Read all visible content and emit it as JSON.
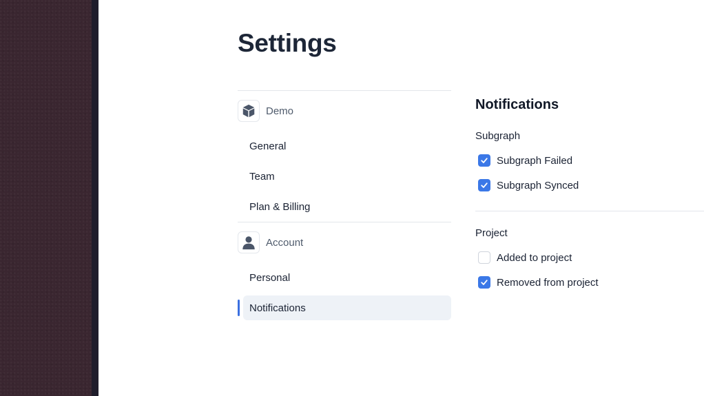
{
  "page": {
    "title": "Settings"
  },
  "sidebar": {
    "sections": [
      {
        "label": "Demo",
        "icon": "cube-icon",
        "items": [
          {
            "label": "General",
            "active": false
          },
          {
            "label": "Team",
            "active": false
          },
          {
            "label": "Plan & Billing",
            "active": false
          }
        ]
      },
      {
        "label": "Account",
        "icon": "user-icon",
        "items": [
          {
            "label": "Personal",
            "active": false
          },
          {
            "label": "Notifications",
            "active": true
          }
        ]
      }
    ]
  },
  "notifications": {
    "title": "Notifications",
    "groups": [
      {
        "title": "Subgraph",
        "options": [
          {
            "label": "Subgraph Failed",
            "checked": true
          },
          {
            "label": "Subgraph Synced",
            "checked": true
          }
        ]
      },
      {
        "title": "Project",
        "options": [
          {
            "label": "Added to project",
            "checked": false
          },
          {
            "label": "Removed from project",
            "checked": true
          }
        ]
      }
    ]
  },
  "colors": {
    "accent": "#3b78e7",
    "active_indicator": "#3b6fe0",
    "active_bg": "#eef2f7",
    "desktop_bg": "#3a2630"
  }
}
